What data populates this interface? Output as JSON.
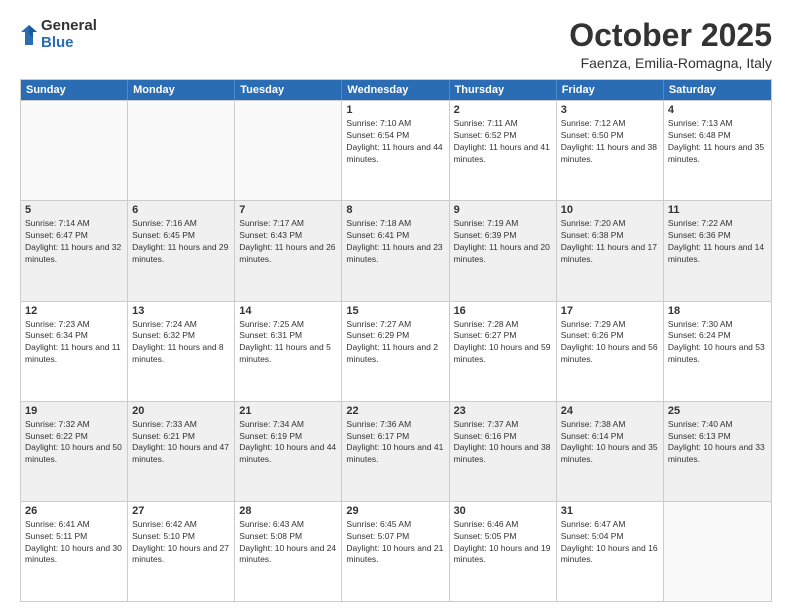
{
  "logo": {
    "general": "General",
    "blue": "Blue"
  },
  "title": "October 2025",
  "location": "Faenza, Emilia-Romagna, Italy",
  "days": [
    "Sunday",
    "Monday",
    "Tuesday",
    "Wednesday",
    "Thursday",
    "Friday",
    "Saturday"
  ],
  "rows": [
    [
      {
        "date": "",
        "info": ""
      },
      {
        "date": "",
        "info": ""
      },
      {
        "date": "",
        "info": ""
      },
      {
        "date": "1",
        "info": "Sunrise: 7:10 AM\nSunset: 6:54 PM\nDaylight: 11 hours and 44 minutes."
      },
      {
        "date": "2",
        "info": "Sunrise: 7:11 AM\nSunset: 6:52 PM\nDaylight: 11 hours and 41 minutes."
      },
      {
        "date": "3",
        "info": "Sunrise: 7:12 AM\nSunset: 6:50 PM\nDaylight: 11 hours and 38 minutes."
      },
      {
        "date": "4",
        "info": "Sunrise: 7:13 AM\nSunset: 6:48 PM\nDaylight: 11 hours and 35 minutes."
      }
    ],
    [
      {
        "date": "5",
        "info": "Sunrise: 7:14 AM\nSunset: 6:47 PM\nDaylight: 11 hours and 32 minutes."
      },
      {
        "date": "6",
        "info": "Sunrise: 7:16 AM\nSunset: 6:45 PM\nDaylight: 11 hours and 29 minutes."
      },
      {
        "date": "7",
        "info": "Sunrise: 7:17 AM\nSunset: 6:43 PM\nDaylight: 11 hours and 26 minutes."
      },
      {
        "date": "8",
        "info": "Sunrise: 7:18 AM\nSunset: 6:41 PM\nDaylight: 11 hours and 23 minutes."
      },
      {
        "date": "9",
        "info": "Sunrise: 7:19 AM\nSunset: 6:39 PM\nDaylight: 11 hours and 20 minutes."
      },
      {
        "date": "10",
        "info": "Sunrise: 7:20 AM\nSunset: 6:38 PM\nDaylight: 11 hours and 17 minutes."
      },
      {
        "date": "11",
        "info": "Sunrise: 7:22 AM\nSunset: 6:36 PM\nDaylight: 11 hours and 14 minutes."
      }
    ],
    [
      {
        "date": "12",
        "info": "Sunrise: 7:23 AM\nSunset: 6:34 PM\nDaylight: 11 hours and 11 minutes."
      },
      {
        "date": "13",
        "info": "Sunrise: 7:24 AM\nSunset: 6:32 PM\nDaylight: 11 hours and 8 minutes."
      },
      {
        "date": "14",
        "info": "Sunrise: 7:25 AM\nSunset: 6:31 PM\nDaylight: 11 hours and 5 minutes."
      },
      {
        "date": "15",
        "info": "Sunrise: 7:27 AM\nSunset: 6:29 PM\nDaylight: 11 hours and 2 minutes."
      },
      {
        "date": "16",
        "info": "Sunrise: 7:28 AM\nSunset: 6:27 PM\nDaylight: 10 hours and 59 minutes."
      },
      {
        "date": "17",
        "info": "Sunrise: 7:29 AM\nSunset: 6:26 PM\nDaylight: 10 hours and 56 minutes."
      },
      {
        "date": "18",
        "info": "Sunrise: 7:30 AM\nSunset: 6:24 PM\nDaylight: 10 hours and 53 minutes."
      }
    ],
    [
      {
        "date": "19",
        "info": "Sunrise: 7:32 AM\nSunset: 6:22 PM\nDaylight: 10 hours and 50 minutes."
      },
      {
        "date": "20",
        "info": "Sunrise: 7:33 AM\nSunset: 6:21 PM\nDaylight: 10 hours and 47 minutes."
      },
      {
        "date": "21",
        "info": "Sunrise: 7:34 AM\nSunset: 6:19 PM\nDaylight: 10 hours and 44 minutes."
      },
      {
        "date": "22",
        "info": "Sunrise: 7:36 AM\nSunset: 6:17 PM\nDaylight: 10 hours and 41 minutes."
      },
      {
        "date": "23",
        "info": "Sunrise: 7:37 AM\nSunset: 6:16 PM\nDaylight: 10 hours and 38 minutes."
      },
      {
        "date": "24",
        "info": "Sunrise: 7:38 AM\nSunset: 6:14 PM\nDaylight: 10 hours and 35 minutes."
      },
      {
        "date": "25",
        "info": "Sunrise: 7:40 AM\nSunset: 6:13 PM\nDaylight: 10 hours and 33 minutes."
      }
    ],
    [
      {
        "date": "26",
        "info": "Sunrise: 6:41 AM\nSunset: 5:11 PM\nDaylight: 10 hours and 30 minutes."
      },
      {
        "date": "27",
        "info": "Sunrise: 6:42 AM\nSunset: 5:10 PM\nDaylight: 10 hours and 27 minutes."
      },
      {
        "date": "28",
        "info": "Sunrise: 6:43 AM\nSunset: 5:08 PM\nDaylight: 10 hours and 24 minutes."
      },
      {
        "date": "29",
        "info": "Sunrise: 6:45 AM\nSunset: 5:07 PM\nDaylight: 10 hours and 21 minutes."
      },
      {
        "date": "30",
        "info": "Sunrise: 6:46 AM\nSunset: 5:05 PM\nDaylight: 10 hours and 19 minutes."
      },
      {
        "date": "31",
        "info": "Sunrise: 6:47 AM\nSunset: 5:04 PM\nDaylight: 10 hours and 16 minutes."
      },
      {
        "date": "",
        "info": ""
      }
    ]
  ]
}
